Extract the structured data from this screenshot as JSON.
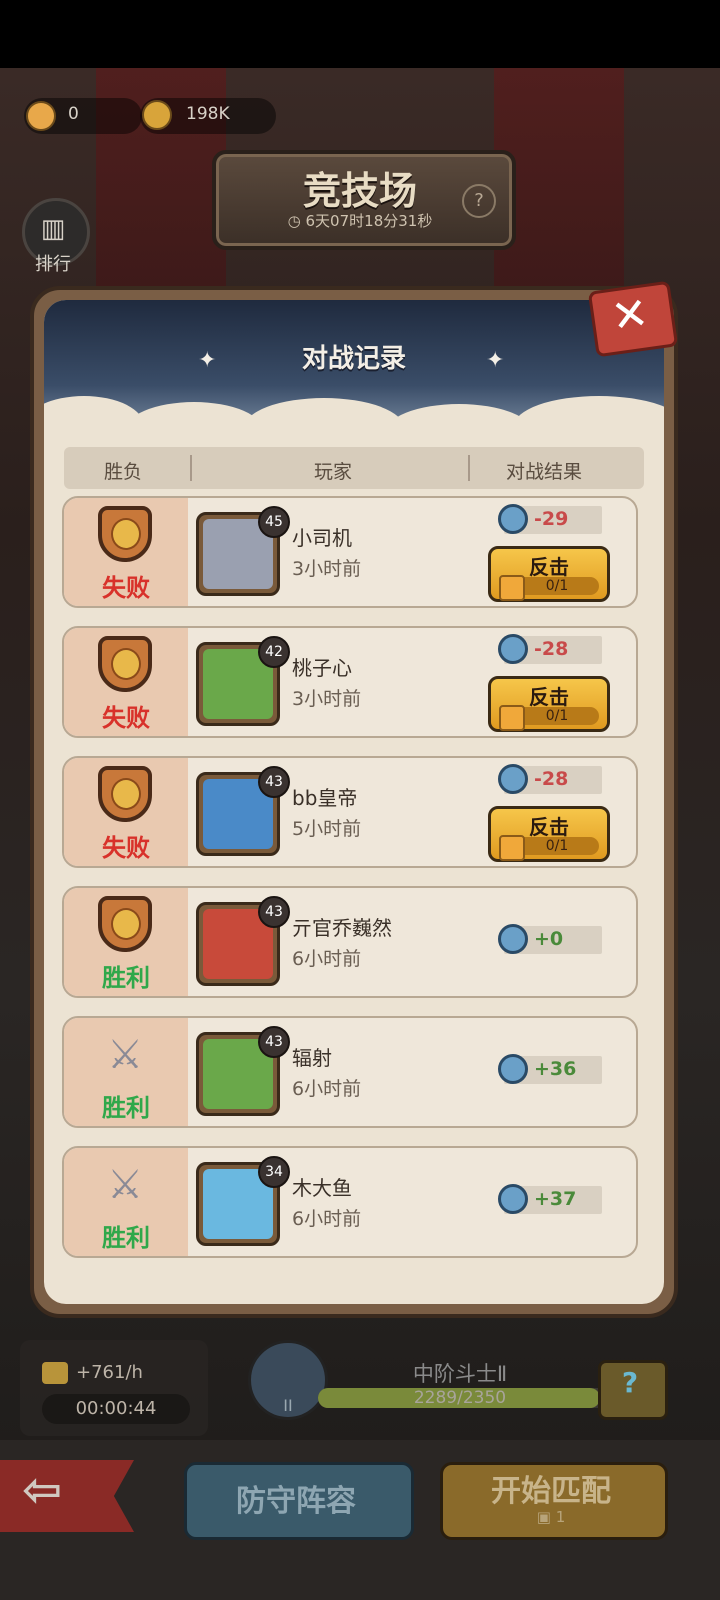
{
  "header": {
    "resource1_value": "0",
    "resource2_value": "198K",
    "title": "竞技场",
    "countdown": "6天07时18分31秒",
    "help_label": "?",
    "rank_button_label": "排行"
  },
  "dialog": {
    "title": "对战记录",
    "close_label": "✕",
    "columns": [
      "胜负",
      "玩家",
      "对战结果"
    ],
    "records": [
      {
        "result": "失败",
        "outcome": "lose",
        "icon": "shield-icon",
        "level": "45",
        "name": "小司机",
        "time": "3小时前",
        "score": "-29",
        "avatar_color": "#9aa0b0",
        "revenge": true
      },
      {
        "result": "失败",
        "outcome": "lose",
        "icon": "shield-icon",
        "level": "42",
        "name": "桃子心",
        "time": "3小时前",
        "score": "-28",
        "avatar_color": "#6aa84a",
        "revenge": true
      },
      {
        "result": "失败",
        "outcome": "lose",
        "icon": "shield-icon",
        "level": "43",
        "name": "bb皇帝",
        "time": "5小时前",
        "score": "-28",
        "avatar_color": "#4a8ac8",
        "revenge": true
      },
      {
        "result": "胜利",
        "outcome": "win",
        "icon": "shield-icon",
        "level": "43",
        "name": "亓官乔巍然",
        "time": "6小时前",
        "score": "+0",
        "avatar_color": "#c84a3a",
        "revenge": false
      },
      {
        "result": "胜利",
        "outcome": "win",
        "icon": "crossed-swords-icon",
        "level": "43",
        "name": "辐射",
        "time": "6小时前",
        "score": "+36",
        "avatar_color": "#6aa84a",
        "revenge": false
      },
      {
        "result": "胜利",
        "outcome": "win",
        "icon": "crossed-swords-icon",
        "level": "34",
        "name": "木大鱼",
        "time": "6小时前",
        "score": "+37",
        "avatar_color": "#6ab8e0",
        "revenge": false
      }
    ],
    "revenge_label": "反击",
    "revenge_count": "0/1"
  },
  "footer": {
    "income_rate": "+761/h",
    "income_timer": "00:00:44",
    "rank_name": "中阶斗士Ⅱ",
    "rank_badge": "II",
    "rank_progress": "2289/2350",
    "rank_progress_fraction": 0.974,
    "defense_button": "防守阵容",
    "match_button": "开始匹配",
    "match_cost": "1"
  }
}
